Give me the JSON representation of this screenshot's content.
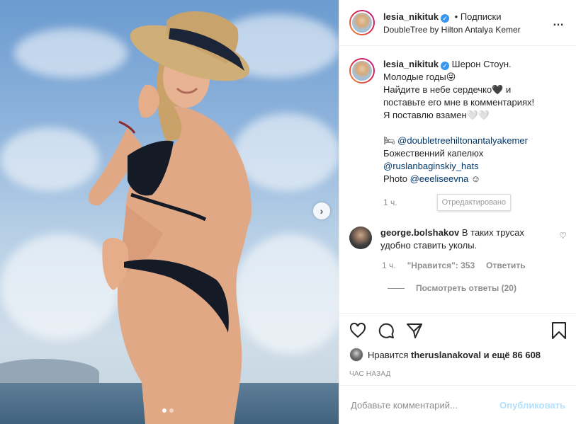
{
  "post": {
    "username": "lesia_nikituk",
    "verified_badge": "✓",
    "follow_label": "• Подписки",
    "location": "DoubleTree by Hilton Antalya Kemer",
    "more_icon": "…",
    "next_icon": "›"
  },
  "caption": {
    "username": "lesia_nikituk",
    "lines": [
      "Шерон Стоун.",
      "Молодые годы😜",
      "Найдите в небе сердечко🖤 и",
      "поставьте его мне в комментариях!",
      "Я поставлю взамен🤍🤍"
    ],
    "bed_emoji": "🛏",
    "hotel_mention": "@doubletreehiltonantalyakemer",
    "hat_line": "Божественний капелюх",
    "hat_mention": "@ruslanbaginskiy_hats",
    "photo_prefix": "Photo",
    "photo_mention": "@eeeliseevna",
    "photo_suffix": "☺",
    "time": "1 ч.",
    "edited_tooltip": "Отредактировано"
  },
  "comment": {
    "username": "george.bolshakov",
    "text": "В таких трусах удобно ставить уколы.",
    "heart_icon": "♡",
    "time": "1 ч.",
    "likes_label": "\"Нравится\": 353",
    "reply_label": "Ответить",
    "view_replies": "Посмотреть ответы (20)"
  },
  "actions": {
    "icons": [
      "heart-icon",
      "comment-icon",
      "share-icon",
      "bookmark-icon"
    ],
    "likes_prefix": "Нравится",
    "likes_user": "theruslanakoval",
    "likes_suffix": "и ещё 86 608",
    "posted_ago": "ЧАС НАЗАД"
  },
  "add_comment": {
    "placeholder": "Добавьте комментарий...",
    "publish_label": "Опубликовать"
  },
  "carousel": {
    "total_slides": 2,
    "active_slide": 1
  },
  "colors": {
    "link": "#00376b",
    "verified": "#3897f0",
    "muted": "#8e8e8e",
    "publish_disabled": "#b2dffc"
  }
}
